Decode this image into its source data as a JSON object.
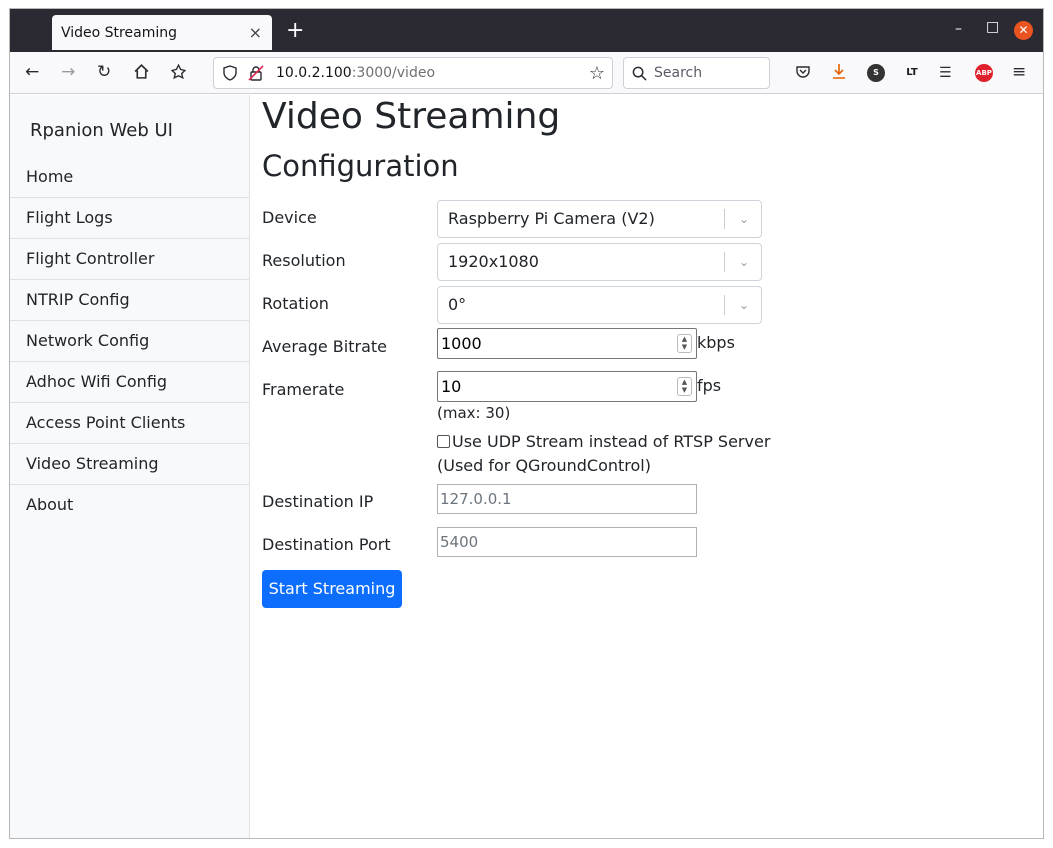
{
  "browser": {
    "tab_title": "Video Streaming",
    "tab_close": "×",
    "new_tab": "+",
    "url_host": "10.0.2.100",
    "url_path": ":3000/video",
    "search_placeholder": "Search"
  },
  "sidebar": {
    "brand": "Rpanion Web UI",
    "items": [
      {
        "label": "Home"
      },
      {
        "label": "Flight Logs"
      },
      {
        "label": "Flight Controller"
      },
      {
        "label": "NTRIP Config"
      },
      {
        "label": "Network Config"
      },
      {
        "label": "Adhoc Wifi Config"
      },
      {
        "label": "Access Point Clients"
      },
      {
        "label": "Video Streaming"
      },
      {
        "label": "About"
      }
    ]
  },
  "main": {
    "title": "Video Streaming",
    "subtitle": "Configuration",
    "device": {
      "label": "Device",
      "value": "Raspberry Pi Camera (V2)"
    },
    "resolution": {
      "label": "Resolution",
      "value": "1920x1080"
    },
    "rotation": {
      "label": "Rotation",
      "value": "0°"
    },
    "bitrate": {
      "label": "Average Bitrate",
      "value": "1000",
      "unit": "kbps"
    },
    "framerate": {
      "label": "Framerate",
      "value": "10",
      "unit": "fps",
      "max_note": "(max: 30)"
    },
    "udp": {
      "label": "Use UDP Stream instead of RTSP Server",
      "note": "(Used for QGroundControl)",
      "checked": false
    },
    "dest_ip": {
      "label": "Destination IP",
      "placeholder": "127.0.0.1"
    },
    "dest_port": {
      "label": "Destination Port",
      "placeholder": "5400"
    },
    "start_button": "Start Streaming"
  },
  "icons": {
    "back": "back-arrow-icon",
    "forward": "forward-arrow-icon",
    "reload": "reload-icon",
    "home": "home-icon",
    "extension": "extensions-icon",
    "shield": "tracking-shield-icon",
    "insecure": "insecure-lock-icon",
    "bookmark": "star-icon",
    "search": "search-icon",
    "pocket": "pocket-icon",
    "download": "download-icon",
    "menu": "hamburger-menu-icon"
  },
  "colors": {
    "accent": "#0d6efd",
    "titlebar": "#2b2a33",
    "close": "#e95420",
    "sidebar_bg": "#f8f9fa"
  }
}
